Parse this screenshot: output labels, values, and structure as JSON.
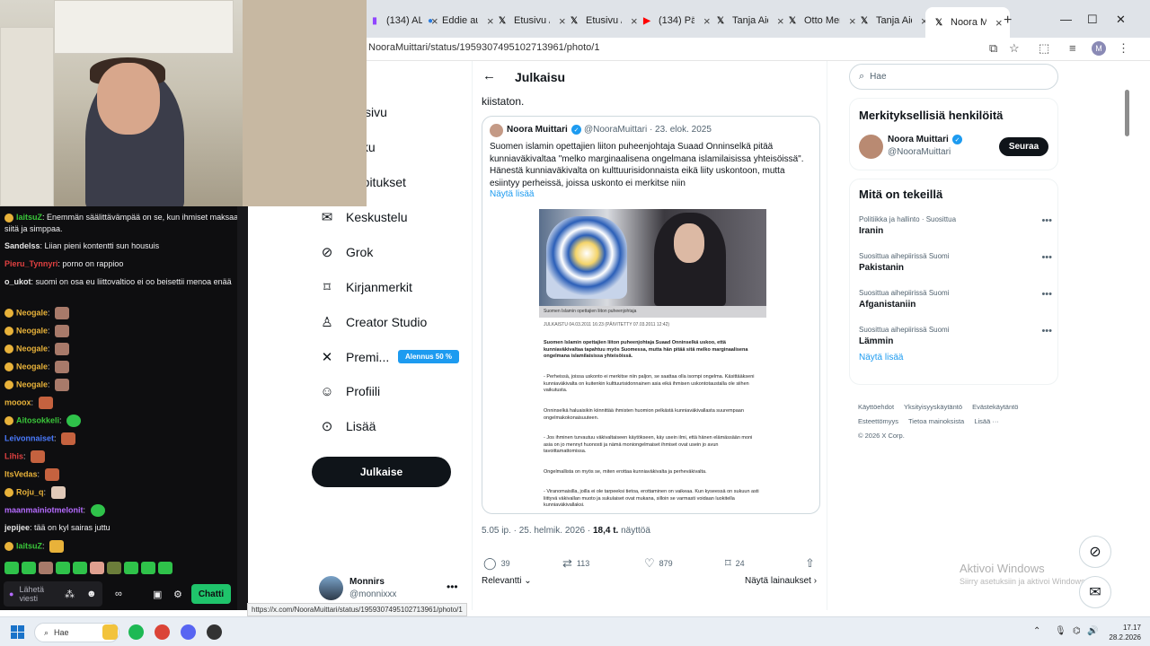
{
  "browser": {
    "tabs": [
      {
        "label": "(134) ALT",
        "icon": "twitch-icon"
      },
      {
        "label": "Eddie au",
        "icon": "tab-icon"
      },
      {
        "label": "Etusivu /",
        "icon": "x-icon"
      },
      {
        "label": "Etusivu /",
        "icon": "x-icon"
      },
      {
        "label": "(134) Päi",
        "icon": "youtube-icon"
      },
      {
        "label": "Tanja Aid",
        "icon": "x-icon"
      },
      {
        "label": "Otto Mer",
        "icon": "x-icon"
      },
      {
        "label": "Tanja Aid",
        "icon": "x-icon"
      },
      {
        "label": "Noora M",
        "icon": "x-icon"
      }
    ],
    "url": "NooraMuittari/status/1959307495102713961/photo/1",
    "profile_initial": "M",
    "status_url": "https://x.com/NooraMuittari/status/1959307495102713961/photo/1"
  },
  "chat": {
    "messages": [
      {
        "user": "laitsuZ",
        "user_color": "#3ac73a",
        "text": "Enemmän säälittävämpää on se, kun ihmiset maksaa siitä ja simppaa."
      },
      {
        "user": "Sandelss",
        "user_color": "#e6e6e6",
        "text": "Liian pieni kontentti sun housuis"
      },
      {
        "user": "Pieru_Tynnyri",
        "user_color": "#e04040",
        "text": "porno on rappioo"
      },
      {
        "user": "o_ukot",
        "user_color": "#e6e6e6",
        "text": "suomi on osa eu liittovaltioo ei oo beisettii menoa enää"
      },
      {
        "user": "Neogale",
        "user_color": "#e8b23a",
        "text": ""
      },
      {
        "user": "Neogale",
        "user_color": "#e8b23a",
        "text": ""
      },
      {
        "user": "Neogale",
        "user_color": "#e8b23a",
        "text": ""
      },
      {
        "user": "Neogale",
        "user_color": "#e8b23a",
        "text": ""
      },
      {
        "user": "Neogale",
        "user_color": "#e8b23a",
        "text": ""
      },
      {
        "user": "mooox",
        "user_color": "#e8b23a",
        "text": ""
      },
      {
        "user": "Aitosokkeli",
        "user_color": "#3ac73a",
        "text": ""
      },
      {
        "user": "Leivonnaiset",
        "user_color": "#4a7bff",
        "text": ""
      },
      {
        "user": "Lihis",
        "user_color": "#e04040",
        "text": ""
      },
      {
        "user": "ItsVedas",
        "user_color": "#e8b23a",
        "text": ""
      },
      {
        "user": "Roju_q",
        "user_color": "#e8b23a",
        "text": ""
      },
      {
        "user": "maanmainiotmelonit",
        "user_color": "#b56bff",
        "text": ""
      },
      {
        "user": "jepijee",
        "user_color": "#e6e6e6",
        "text": "tää on kyl sairas juttu"
      },
      {
        "user": "laitsuZ",
        "user_color": "#3ac73a",
        "text": ""
      }
    ],
    "input_placeholder": "Lähetä viesti",
    "send_label": "Chatti"
  },
  "nav": {
    "items": [
      {
        "label": "Etusivu",
        "icon": "home-icon"
      },
      {
        "label": "Haku",
        "icon": "search-icon"
      },
      {
        "label": "Ilmoitukset",
        "icon": "bell-icon"
      },
      {
        "label": "Keskustelu",
        "icon": "mail-icon"
      },
      {
        "label": "Grok",
        "icon": "grok-icon"
      },
      {
        "label": "Kirjanmerkit",
        "icon": "bookmark-icon"
      },
      {
        "label": "Creator Studio",
        "icon": "creator-icon"
      },
      {
        "label": "Premi...",
        "icon": "x-logo-icon"
      },
      {
        "label": "Profiili",
        "icon": "person-icon"
      },
      {
        "label": "Lisää",
        "icon": "more-circle-icon"
      }
    ],
    "premium_badge": "Alennus 50 %",
    "post_button": "Julkaise",
    "account": {
      "name": "Monnirs",
      "handle": "@monnixxx"
    }
  },
  "main": {
    "title": "Julkaisu",
    "text_tail": "kiistaton.",
    "quote": {
      "name": "Noora Muittari",
      "handle": "@NooraMuittari · 23. elok. 2025",
      "text": "Suomen islamin opettajien liiton puheenjohtaja Suaad Onninselkä pitää kunniaväkivaltaa \"melko marginaalisena ongelmana islamilaisissa yhteisöissä\". Hänestä kunniaväkivalta on kulttuurisidonnaista eikä liity uskontoon, mutta esiintyy perheissä, joissa uskonto ei merkitse niin",
      "show_more": "Näytä lisää",
      "image": {
        "caption": "Suomen Islamin opettajien liiton puheenjohtaja",
        "date": "JULKAISTU 04.03.2011 16:23  (PÄIVITETTY 07.03.2011 12:42)",
        "paragraphs": [
          "Suomen Islamin opettajien liiton puheenjohtaja Suaad Onninselkä uskoo, että kunniaväkivaltaa tapahtuu myös Suomessa, mutta hän pitää sitä melko marginaalisena ongelmana islamilaisissa yhteisöissä.",
          "- Perheissä, joissa uskonto ei merkitse niin paljon, se saattaa olla isompi ongelma. Käsittääkseni kunniaväkivalta on kuitenkin kulttuurisidonnainen asia eikä ihmisen uskontotaustalla ole siihen vaikutusta.",
          "Onninselkä haluaisikin kiinnittää ihmisten huomion pelkästä kunniaväkivallasta suurempaan ongelmakokonaisuuteen.",
          "- Jos ihminen turvautuu väkivaltaiseen käytökseen, käy usein ilmi, että hänen elämässään moni asia on jo mennyt huonosti ja nämä moniongelmaiset ihmiset ovat usein jo avun tavoittamattomissa.",
          "Ongelmallista on myös se, miten erottaa kunniaväkivalta ja perheväkivalta.",
          "- Viranomaisilla, joilla ei ole tarpeeksi tietoa, erottaminen on vaikeaa. Kun kyseessä on sukuun asti liittyvä väkivallan muoto ja sukulaiset ovat mukana, silloin se varmasti voidaan luokitella kunniaväkivallaksi."
        ]
      }
    },
    "meta_time": "5.05 ip. · 25. helmik. 2026 · ",
    "meta_views": "18,4 t.",
    "meta_views_label": " näyttöä",
    "actions": [
      {
        "icon": "reply-icon",
        "count": "39"
      },
      {
        "icon": "repost-icon",
        "count": "113"
      },
      {
        "icon": "like-icon",
        "count": "879"
      },
      {
        "icon": "bookmark-icon",
        "count": "24"
      },
      {
        "icon": "share-icon",
        "count": ""
      }
    ],
    "relevance": "Relevantti",
    "quotes_link": "Näytä lainaukset"
  },
  "sidebar": {
    "search_placeholder": "Hae",
    "relevant_title": "Merkityksellisiä henkilöitä",
    "relevant_person": {
      "name": "Noora Muittari",
      "handle": "@NooraMuittari"
    },
    "follow_label": "Seuraa",
    "trends_title": "Mitä on tekeillä",
    "trends": [
      {
        "category": "Politiikka ja hallinto · Suosittua",
        "name": "Iranin"
      },
      {
        "category": "Suosittua aihepiirissä Suomi",
        "name": "Pakistanin"
      },
      {
        "category": "Suosittua aihepiirissä Suomi",
        "name": "Afganistaniin"
      },
      {
        "category": "Suosittua aihepiirissä Suomi",
        "name": "Lämmin"
      }
    ],
    "trends_more": "Näytä lisää",
    "footer": [
      "Käyttöehdot",
      "Yksityisyyskäytäntö",
      "Evästekäytäntö",
      "Esteettömyys",
      "Tietoa mainoksista",
      "Lisää ···",
      "© 2026 X Corp."
    ]
  },
  "windows": {
    "activate_title": "Aktivoi Windows",
    "activate_sub": "Siirry asetuksiin ja aktivoi Windows.",
    "taskbar_search": "Hae",
    "time": "17.17",
    "date": "28.2.2026"
  },
  "colors": {
    "x_blue": "#1d9bf0",
    "x_black": "#0f1419",
    "twitch_bg": "#0e0e10",
    "twitch_green": "#1fc46b"
  }
}
